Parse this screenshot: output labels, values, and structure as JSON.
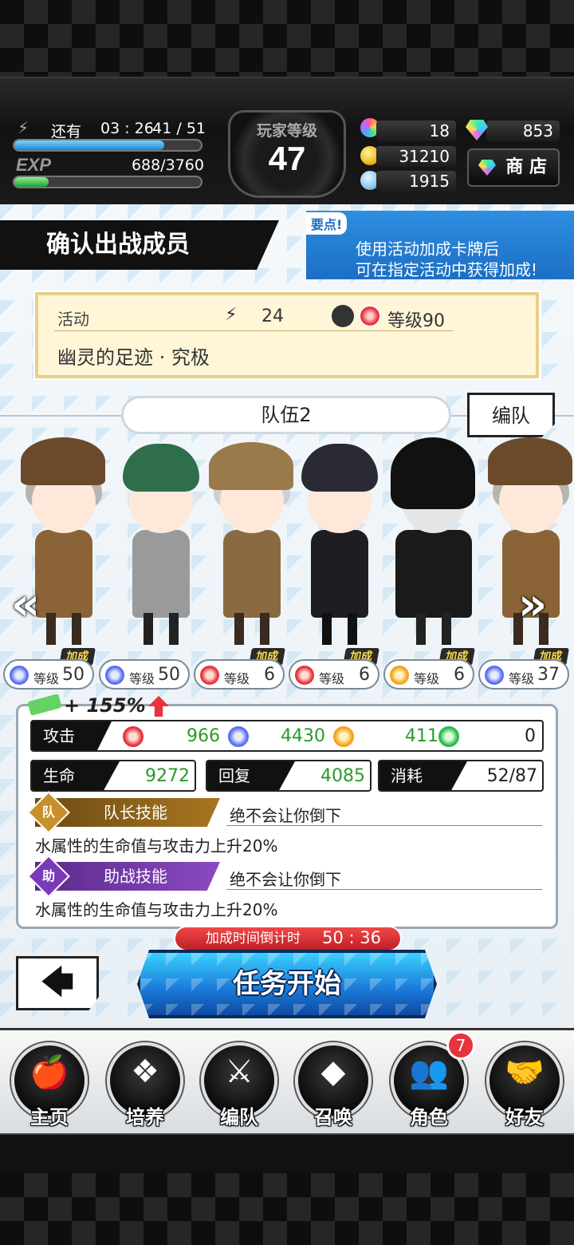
{
  "status": {
    "stamina_timer_label": "还有",
    "stamina_timer": "03 : 26",
    "stamina_count": "41 / 51",
    "stamina_progress": 0.804,
    "exp_label": "EXP",
    "exp_value": "688/3760",
    "exp_progress": 0.183,
    "player_level_label": "玩家等级",
    "player_level": "47",
    "pencil_count": "18",
    "gem_count": "853",
    "coin_count": "31210",
    "orb_count": "1915",
    "shop_label": "商 店"
  },
  "header": {
    "title": "确认出战成员",
    "tip_badge": "要点!",
    "tip_line1": "使用活动加成卡牌后",
    "tip_line2": "可在指定活动中获得加成!"
  },
  "activity": {
    "label": "活动",
    "stamina_cost": "24",
    "level": "等级90",
    "name": "幽灵的足迹 · 究极"
  },
  "team": {
    "name": "队伍2",
    "edit_label": "编队",
    "members": [
      {
        "element": "water",
        "level_label": "等级",
        "level": "50",
        "boost": "加成"
      },
      {
        "element": "water",
        "level_label": "等级",
        "level": "50",
        "boost": ""
      },
      {
        "element": "fire",
        "level_label": "等级",
        "level": "6",
        "boost": "加成"
      },
      {
        "element": "fire",
        "level_label": "等级",
        "level": "6",
        "boost": "加成"
      },
      {
        "element": "light",
        "level_label": "等级",
        "level": "6",
        "boost": "加成"
      },
      {
        "element": "water",
        "level_label": "等级",
        "level": "37",
        "boost": "加成"
      }
    ]
  },
  "stats": {
    "bonus": "+ 155%",
    "attack_label": "攻击",
    "atk_fire": "966",
    "atk_water": "4430",
    "atk_light": "411",
    "atk_wind": "0",
    "hp_label": "生命",
    "hp": "9272",
    "recover_label": "回复",
    "recover": "4085",
    "cost_label": "消耗",
    "cost": "52/87",
    "leader_badge": "队",
    "leader_label": "队长技能",
    "leader_skill": "绝不会让你倒下",
    "leader_desc": "水属性的生命值与攻击力上升20%",
    "support_badge": "助",
    "support_label": "助战技能",
    "support_skill": "绝不会让你倒下",
    "support_desc": "水属性的生命值与攻击力上升20%"
  },
  "actions": {
    "countdown_label": "加成时间倒计时",
    "countdown": "50 : 36",
    "start_label": "任务开始",
    "back_glyph": "🡄"
  },
  "nav": {
    "items": [
      {
        "label": "主页",
        "icon": "apple-icon"
      },
      {
        "label": "培养",
        "icon": "gems-icon"
      },
      {
        "label": "编队",
        "icon": "crossed-swords-icon"
      },
      {
        "label": "召唤",
        "icon": "diamond-icon"
      },
      {
        "label": "角色",
        "icon": "people-icon"
      },
      {
        "label": "好友",
        "icon": "handshake-icon"
      }
    ],
    "role_badge": "7"
  },
  "colors": {
    "accent_blue": "#1b6fc4",
    "fire": "#e8323c",
    "water": "#5b6ff0",
    "light": "#f7a11a",
    "wind": "#2cb84c"
  }
}
